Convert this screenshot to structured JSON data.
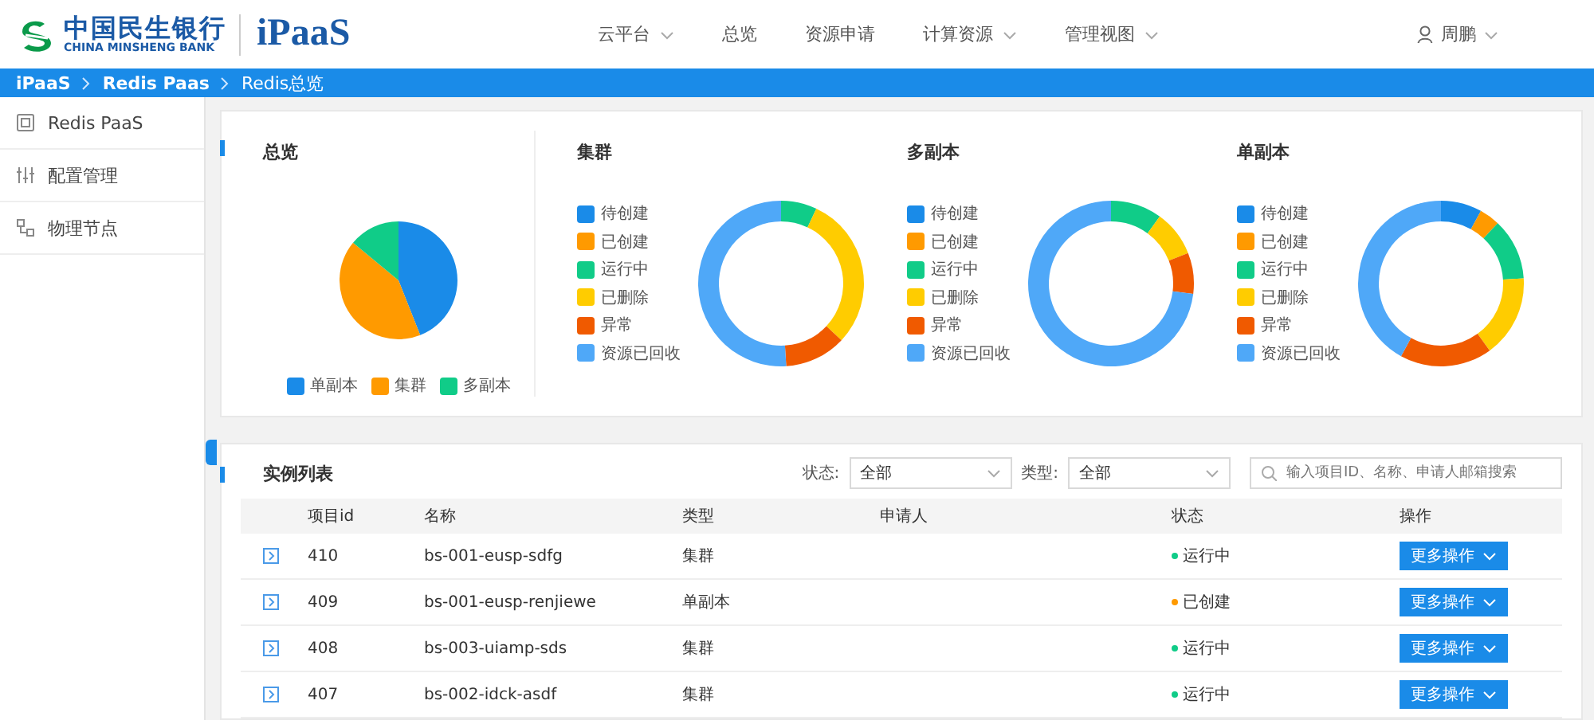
{
  "header": {
    "logo_cn": "中国民生银行",
    "logo_en": "CHINA MINSHENG BANK",
    "product": "iPaaS",
    "nav": [
      {
        "label": "云平台",
        "dropdown": true
      },
      {
        "label": "总览",
        "dropdown": false
      },
      {
        "label": "资源申请",
        "dropdown": false
      },
      {
        "label": "计算资源",
        "dropdown": true
      },
      {
        "label": "管理视图",
        "dropdown": true
      }
    ],
    "user": {
      "name": "周鹏"
    }
  },
  "breadcrumb": [
    {
      "label": "iPaaS",
      "current": false
    },
    {
      "label": "Redis Paas",
      "current": false
    },
    {
      "label": "Redis总览",
      "current": true
    }
  ],
  "sidebar": {
    "items": [
      {
        "label": "Redis PaaS",
        "kind": "redis"
      },
      {
        "label": "配置管理",
        "kind": "config"
      },
      {
        "label": "物理节点",
        "kind": "nodes"
      }
    ]
  },
  "overview": {
    "panels": [
      {
        "title": "总览",
        "kind": "pie",
        "legend": [
          {
            "label": "单副本",
            "color": "#1a8be8"
          },
          {
            "label": "集群",
            "color": "#ff9a00"
          },
          {
            "label": "多副本",
            "color": "#10cc88"
          }
        ]
      },
      {
        "title": "集群",
        "kind": "donut",
        "legend": [
          {
            "label": "待创建",
            "color": "#1a8be8"
          },
          {
            "label": "已创建",
            "color": "#ff9a00"
          },
          {
            "label": "运行中",
            "color": "#10cc88"
          },
          {
            "label": "已删除",
            "color": "#ffcc00"
          },
          {
            "label": "异常",
            "color": "#f05a00"
          },
          {
            "label": "资源已回收",
            "color": "#4fa8f8"
          }
        ]
      },
      {
        "title": "多副本",
        "kind": "donut",
        "legend": [
          {
            "label": "待创建",
            "color": "#1a8be8"
          },
          {
            "label": "已创建",
            "color": "#ff9a00"
          },
          {
            "label": "运行中",
            "color": "#10cc88"
          },
          {
            "label": "已删除",
            "color": "#ffcc00"
          },
          {
            "label": "异常",
            "color": "#f05a00"
          },
          {
            "label": "资源已回收",
            "color": "#4fa8f8"
          }
        ]
      },
      {
        "title": "单副本",
        "kind": "donut",
        "legend": [
          {
            "label": "待创建",
            "color": "#1a8be8"
          },
          {
            "label": "已创建",
            "color": "#ff9a00"
          },
          {
            "label": "运行中",
            "color": "#10cc88"
          },
          {
            "label": "已删除",
            "color": "#ffcc00"
          },
          {
            "label": "异常",
            "color": "#f05a00"
          },
          {
            "label": "资源已回收",
            "color": "#4fa8f8"
          }
        ]
      }
    ]
  },
  "instances": {
    "title": "实例列表",
    "filters": [
      {
        "label": "状态:",
        "value": "全部"
      },
      {
        "label": "类型:",
        "value": "全部"
      }
    ],
    "search": {
      "placeholder": "输入项目ID、名称、申请人邮箱搜索"
    },
    "columns": [
      "项目id",
      "名称",
      "类型",
      "申请人",
      "状态",
      "操作"
    ],
    "rows": [
      {
        "id": "410",
        "name": "bs-001-eusp-sdfg",
        "type": "集群",
        "status": "运行中",
        "color": "#10cc88",
        "action": "更多操作"
      },
      {
        "id": "409",
        "name": "bs-001-eusp-renjiewe",
        "type": "单副本",
        "status": "已创建",
        "color": "#ff9a00",
        "action": "更多操作"
      },
      {
        "id": "408",
        "name": "bs-003-uiamp-sds",
        "type": "集群",
        "status": "运行中",
        "color": "#10cc88",
        "action": "更多操作"
      },
      {
        "id": "407",
        "name": "bs-002-idck-asdf",
        "type": "集群",
        "status": "运行中",
        "color": "#10cc88",
        "action": "更多操作"
      }
    ]
  }
}
